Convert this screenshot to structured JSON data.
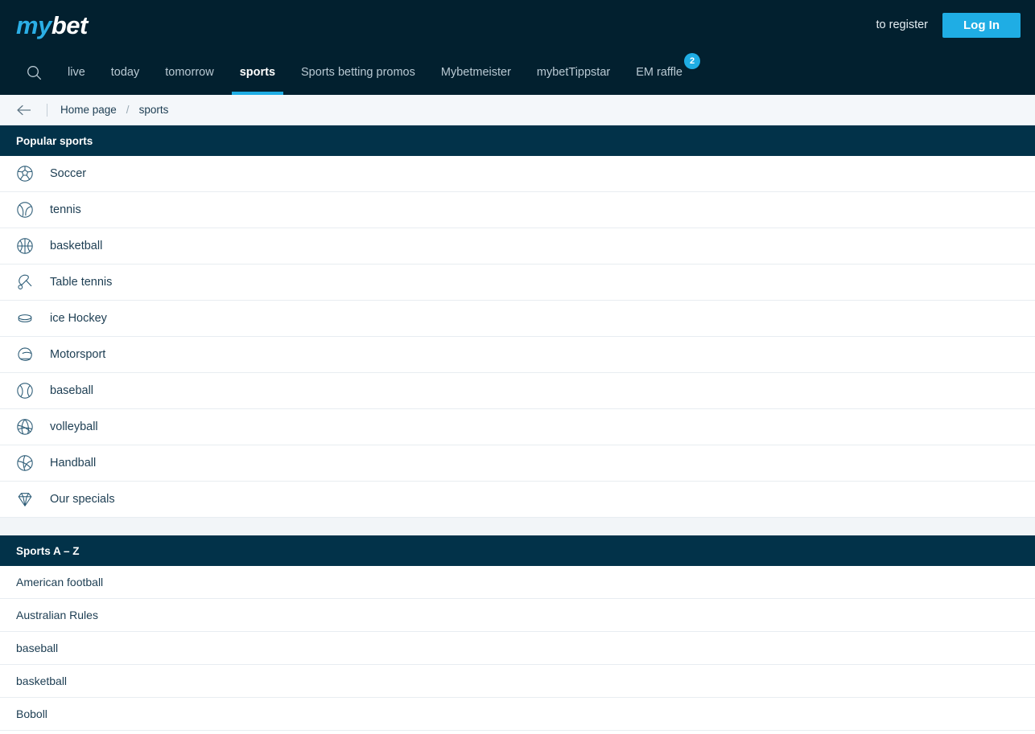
{
  "brand": {
    "logo_part1": "my",
    "logo_part2": "bet",
    "accent_color": "#1fade4",
    "dark_color": "#02202f",
    "header_bar_color": "#023249"
  },
  "topbar": {
    "register_label": "to register",
    "login_label": "Log In"
  },
  "nav": {
    "search_icon": "search-icon",
    "items": [
      {
        "label": "live",
        "active": false
      },
      {
        "label": "today",
        "active": false
      },
      {
        "label": "tomorrow",
        "active": false
      },
      {
        "label": "sports",
        "active": true
      },
      {
        "label": "Sports betting promos",
        "active": false
      },
      {
        "label": "Mybetmeister",
        "active": false
      },
      {
        "label": "mybetTippstar",
        "active": false
      },
      {
        "label": "EM raffle",
        "active": false,
        "badge": "2"
      }
    ]
  },
  "breadcrumb": {
    "back_icon": "arrow-left-icon",
    "home_label": "Home page",
    "separator": "/",
    "current_label": "sports"
  },
  "popular_sports": {
    "title": "Popular sports",
    "items": [
      {
        "label": "Soccer",
        "icon": "soccer-ball-icon"
      },
      {
        "label": "tennis",
        "icon": "tennis-ball-icon"
      },
      {
        "label": "basketball",
        "icon": "basketball-icon"
      },
      {
        "label": "Table tennis",
        "icon": "table-tennis-paddle-icon"
      },
      {
        "label": "ice Hockey",
        "icon": "hockey-puck-icon"
      },
      {
        "label": "Motorsport",
        "icon": "racing-helmet-icon"
      },
      {
        "label": "baseball",
        "icon": "baseball-icon"
      },
      {
        "label": "volleyball",
        "icon": "volleyball-icon"
      },
      {
        "label": "Handball",
        "icon": "handball-icon"
      },
      {
        "label": "Our specials",
        "icon": "diamond-icon"
      }
    ]
  },
  "sports_az": {
    "title": "Sports A – Z",
    "items": [
      {
        "label": "American football"
      },
      {
        "label": "Australian Rules"
      },
      {
        "label": "baseball"
      },
      {
        "label": "basketball"
      },
      {
        "label": "Boboll"
      }
    ]
  }
}
